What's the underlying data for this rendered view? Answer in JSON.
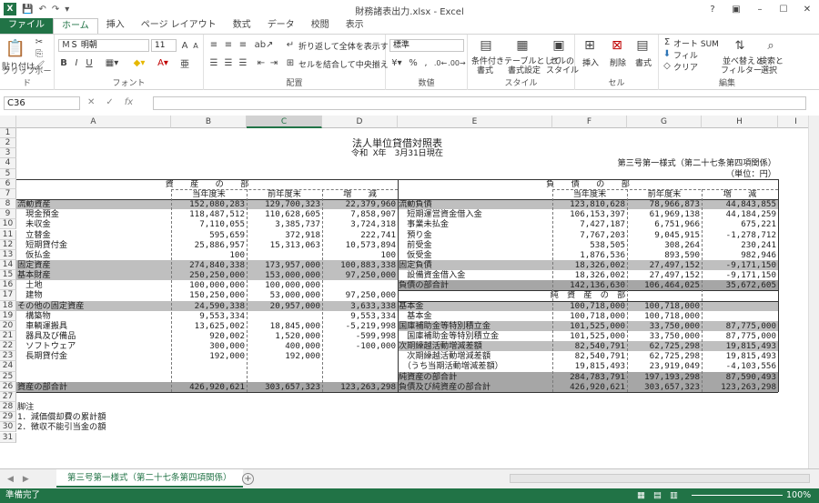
{
  "window": {
    "title": "財務諸表出力.xlsx - Excel",
    "app_badge": "X",
    "controls": {
      "help": "?",
      "ribbon": "▣",
      "minimize": "–",
      "maximize": "☐",
      "close": "✕"
    }
  },
  "ribbon_tabs": [
    "ファイル",
    "ホーム",
    "挿入",
    "ページ レイアウト",
    "数式",
    "データ",
    "校閲",
    "表示"
  ],
  "ribbon": {
    "paste_label": "貼り付け",
    "clipboard_label": "クリップボード",
    "font_name": "ＭＳ 明朝",
    "font_size": "11",
    "font_label": "フォント",
    "wrap_text": "折り返して全体を表示する",
    "merge_center": "セルを結合して中央揃え",
    "alignment_label": "配置",
    "number_format": "標準",
    "number_label": "数値",
    "cond_format": "条件付き\n書式",
    "cond_format_1": "条件付き",
    "cond_format_2": "書式",
    "table_format_1": "テーブルとして",
    "table_format_2": "書式設定",
    "cell_style_1": "セルの",
    "cell_style_2": "スタイル",
    "style_label": "スタイル",
    "insert": "挿入",
    "delete": "削除",
    "format": "書式",
    "cells_label": "セル",
    "autosum": "オート SUM",
    "fill": "フィル",
    "clear": "クリア",
    "sort_1": "並べ替えと",
    "sort_2": "フィルター",
    "find_1": "検索と",
    "find_2": "選択",
    "editing_label": "編集"
  },
  "formula_bar": {
    "name_box": "C36",
    "fx": "fx",
    "value": ""
  },
  "columns": [
    "A",
    "B",
    "C",
    "D",
    "E",
    "F",
    "G",
    "H",
    "I"
  ],
  "rows": [
    "1",
    "2",
    "3",
    "4",
    "5",
    "6",
    "7",
    "8",
    "9",
    "10",
    "11",
    "12",
    "13",
    "14",
    "15",
    "16",
    "17",
    "18",
    "19",
    "20",
    "21",
    "22",
    "23",
    "24",
    "25",
    "26",
    "27",
    "28",
    "29",
    "30",
    "31"
  ],
  "sheet": {
    "title": "法人単位貸借対照表",
    "subtitle": "令和 X年　3月31日現在",
    "form_name": "第三号第一様式（第二十七条第四項関係）",
    "unit": "（単位：円）",
    "assets_header": "資　　産　　の　　部",
    "liab_header": "負　　債　　の　　部",
    "col_current": "当年度末",
    "col_prev": "前年度末",
    "col_diff": "増　　減",
    "assets": [
      {
        "name": "流動資産",
        "cur": "152,080,283",
        "prev": "129,700,323",
        "diff": "22,379,960",
        "shade": true
      },
      {
        "name": "　現金預金",
        "cur": "118,487,512",
        "prev": "110,628,605",
        "diff": "7,858,907"
      },
      {
        "name": "　未収金",
        "cur": "7,110,055",
        "prev": "3,385,737",
        "diff": "3,724,318"
      },
      {
        "name": "　立替金",
        "cur": "595,659",
        "prev": "372,918",
        "diff": "222,741"
      },
      {
        "name": "　短期貸付金",
        "cur": "25,886,957",
        "prev": "15,313,063",
        "diff": "10,573,894"
      },
      {
        "name": "　仮払金",
        "cur": "100",
        "prev": "",
        "diff": "100"
      },
      {
        "name": "固定資産",
        "cur": "274,840,338",
        "prev": "173,957,000",
        "diff": "100,883,338",
        "shade": true
      },
      {
        "name": "基本財産",
        "cur": "250,250,000",
        "prev": "153,000,000",
        "diff": "97,250,000",
        "shade": true
      },
      {
        "name": "　土地",
        "cur": "100,000,000",
        "prev": "100,000,000",
        "diff": ""
      },
      {
        "name": "　建物",
        "cur": "150,250,000",
        "prev": "53,000,000",
        "diff": "97,250,000"
      },
      {
        "name": "その他の固定資産",
        "cur": "24,590,338",
        "prev": "20,957,000",
        "diff": "3,633,338",
        "shade": true
      },
      {
        "name": "　構築物",
        "cur": "9,553,334",
        "prev": "",
        "diff": "9,553,334"
      },
      {
        "name": "　車輌運搬具",
        "cur": "13,625,002",
        "prev": "18,845,000",
        "diff": "-5,219,998"
      },
      {
        "name": "　器具及び備品",
        "cur": "920,002",
        "prev": "1,520,000",
        "diff": "-599,998"
      },
      {
        "name": "　ソフトウェア",
        "cur": "300,000",
        "prev": "400,000",
        "diff": "-100,000"
      },
      {
        "name": "　長期貸付金",
        "cur": "192,000",
        "prev": "192,000",
        "diff": ""
      }
    ],
    "assets_total": {
      "name": "資産の部合計",
      "cur": "426,920,621",
      "prev": "303,657,323",
      "diff": "123,263,298"
    },
    "liabilities": [
      {
        "name": "流動負債",
        "cur": "123,810,628",
        "prev": "78,966,873",
        "diff": "44,843,855",
        "shade": true
      },
      {
        "name": "　短期運営資金借入金",
        "cur": "106,153,397",
        "prev": "61,969,138",
        "diff": "44,184,259"
      },
      {
        "name": "　事業未払金",
        "cur": "7,427,187",
        "prev": "6,751,966",
        "diff": "675,221"
      },
      {
        "name": "　預り金",
        "cur": "7,767,203",
        "prev": "9,045,915",
        "diff": "-1,278,712"
      },
      {
        "name": "　前受金",
        "cur": "538,505",
        "prev": "308,264",
        "diff": "230,241"
      },
      {
        "name": "　仮受金",
        "cur": "1,876,536",
        "prev": "893,590",
        "diff": "982,946"
      },
      {
        "name": "固定負債",
        "cur": "18,326,002",
        "prev": "27,497,152",
        "diff": "-9,171,150",
        "shade": true
      },
      {
        "name": "　設備資金借入金",
        "cur": "18,326,002",
        "prev": "27,497,152",
        "diff": "-9,171,150"
      }
    ],
    "liab_total": {
      "name": "負債の部合計",
      "cur": "142,136,630",
      "prev": "106,464,025",
      "diff": "35,672,605"
    },
    "net_assets_header": "純　資　産　の　部",
    "net_assets": [
      {
        "name": "基本金",
        "cur": "100,718,000",
        "prev": "100,718,000",
        "diff": "",
        "shade": true
      },
      {
        "name": "　基本金",
        "cur": "100,718,000",
        "prev": "100,718,000",
        "diff": ""
      },
      {
        "name": "国庫補助金等特別積立金",
        "cur": "101,525,000",
        "prev": "33,750,000",
        "diff": "87,775,000",
        "shade": true
      },
      {
        "name": "　国庫補助金等特別積立金",
        "cur": "101,525,000",
        "prev": "33,750,000",
        "diff": "87,775,000"
      },
      {
        "name": "次期繰越活動増減差額",
        "cur": "82,540,791",
        "prev": "62,725,298",
        "diff": "19,815,493",
        "shade": true
      },
      {
        "name": "　次期繰越活動増減差額",
        "cur": "82,540,791",
        "prev": "62,725,298",
        "diff": "19,815,493"
      },
      {
        "name": "　（うち当期活動増減差額）",
        "cur": "19,815,493",
        "prev": "23,919,049",
        "diff": "-4,103,556"
      }
    ],
    "net_total": {
      "name": "純資産の部合計",
      "cur": "284,783,791",
      "prev": "197,193,298",
      "diff": "87,590,493"
    },
    "grand_total": {
      "name": "負債及び純資産の部合計",
      "cur": "426,920,621",
      "prev": "303,657,323",
      "diff": "123,263,298"
    },
    "notes_title": "脚注",
    "notes": [
      "1．減価償却費の累計額",
      "2．徴収不能引当金の額"
    ]
  },
  "sheet_tab": "第三号第一様式（第二十七条第四項関係）",
  "status": {
    "ready": "準備完了",
    "zoom": "100%"
  }
}
